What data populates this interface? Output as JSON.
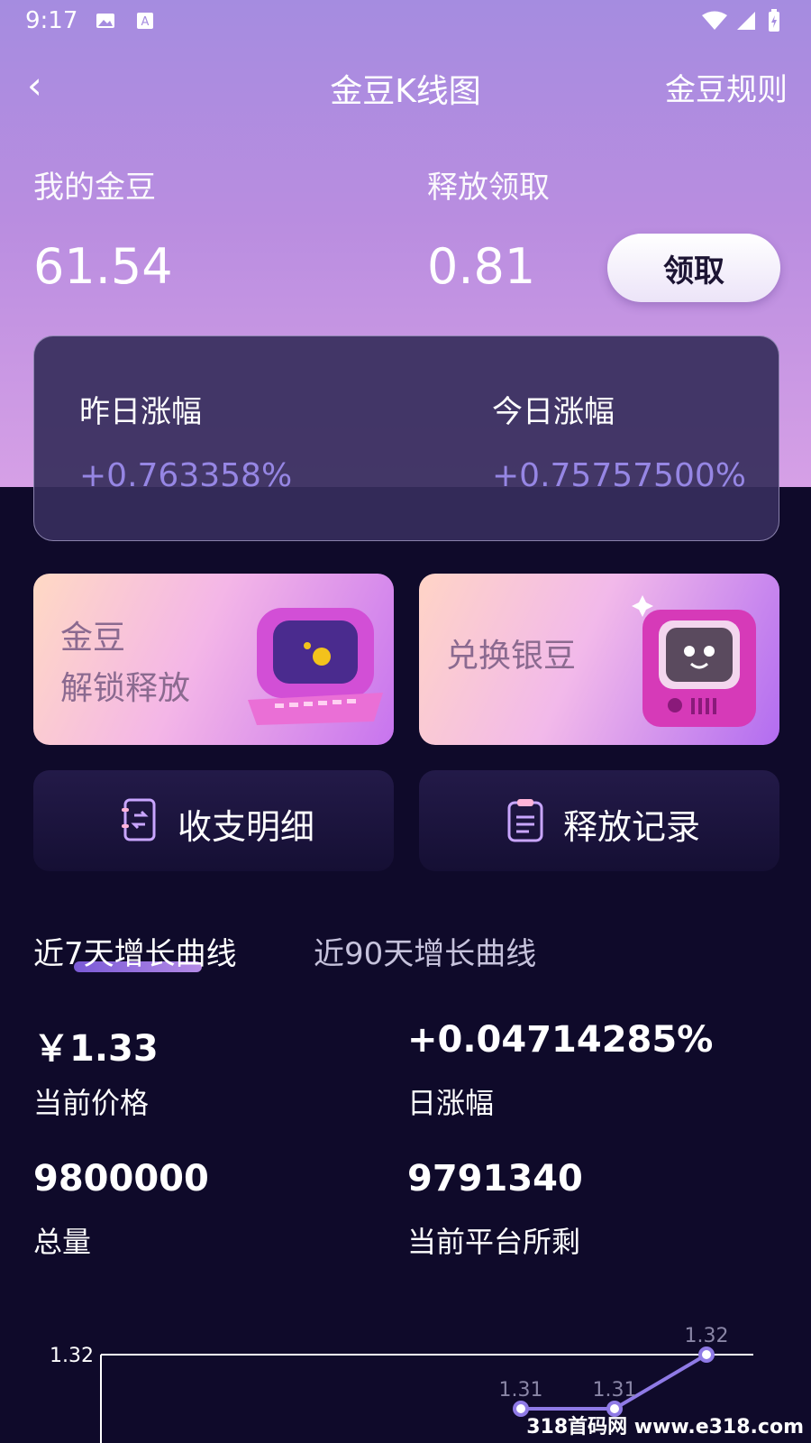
{
  "status_bar": {
    "time": "9:17"
  },
  "nav": {
    "back_icon": "‹",
    "title": "金豆K线图",
    "rules_link": "金豆规则"
  },
  "wallet": {
    "my_beans_label": "我的金豆",
    "my_beans_value": "61.54",
    "release_label": "释放领取",
    "release_value": "0.81",
    "claim_button": "领取"
  },
  "change": {
    "yesterday_label": "昨日涨幅",
    "yesterday_value": "+0.763358%",
    "today_label": "今日涨幅",
    "today_value": "+0.75757500%"
  },
  "promos": {
    "unlock_line1": "金豆",
    "unlock_line2": "解锁释放",
    "exchange": "兑换银豆"
  },
  "actions": {
    "ledger": "收支明细",
    "release_records": "释放记录"
  },
  "tabs": {
    "tab_7d": "近7天增长曲线",
    "tab_90d": "近90天增长曲线"
  },
  "stats": {
    "price_value": "￥1.33",
    "price_label": "当前价格",
    "daily_change_value": "+0.04714285%",
    "daily_change_label": "日涨幅",
    "total_value": "9800000",
    "total_label": "总量",
    "remaining_value": "9791340",
    "remaining_label": "当前平台所剩"
  },
  "chart_data": {
    "type": "line",
    "y_tick_labels": [
      "1.32"
    ],
    "points": [
      {
        "value": 1.31,
        "label": "1.31"
      },
      {
        "value": 1.31,
        "label": "1.31"
      },
      {
        "value": 1.32,
        "label": "1.32"
      }
    ],
    "line_color": "#8f7ae6"
  },
  "watermark": "318首码网 www.e318.com"
}
